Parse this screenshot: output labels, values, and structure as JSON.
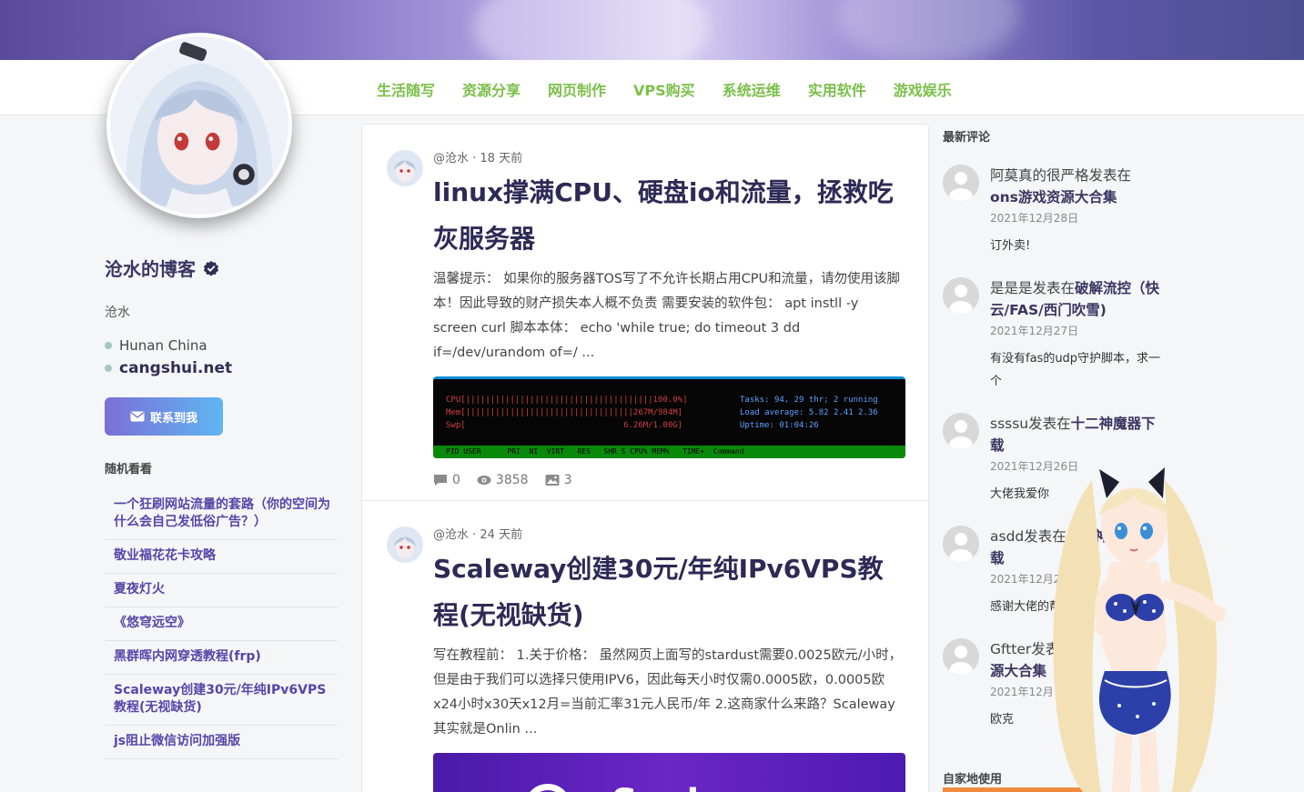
{
  "nav": {
    "items": [
      "生活随写",
      "资源分享",
      "网页制作",
      "VPS购买",
      "系统运维",
      "实用软件",
      "游戏娱乐"
    ]
  },
  "profile": {
    "title": "沧水的博客",
    "subtitle": "沧水",
    "location": "Hunan China",
    "site": "cangshui.net",
    "contact_label": "联系到我"
  },
  "random": {
    "heading": "随机看看",
    "items": [
      "一个狂刷网站流量的套路（你的空间为什么会自己发低俗广告？）",
      "敬业福花花卡攻略",
      "夏夜灯火",
      "《悠穹远空》",
      "黑群晖内网穿透教程(frp)",
      "Scaleway创建30元/年纯IPv6VPS教程(无视缺货)",
      "js阻止微信访问加强版"
    ]
  },
  "posts": [
    {
      "meta": "@沧水 · 18 天前",
      "title": "linux撑满CPU、硬盘io和流量，拯救吃灰服务器",
      "excerpt": "温馨提示： 如果你的服务器TOS写了不允许长期占用CPU和流量，请勿使用该脚本！因此导致的财产损失本人概不负责 需要安装的软件包： apt instll -y screen curl 脚本本体： echo 'while true; do timeout 3 dd if=/dev/urandom of=/ ...",
      "comments": "0",
      "views": "3858",
      "images": "3",
      "term": {
        "left": "CPU[||||||||||||||||||||||||||||||||||||||100.0%]\nMem[||||||||||||||||||||||||||||||||||267M/984M]\nSwp[                                6.26M/1.00G]",
        "right": "Tasks: 94, 29 thr; 2 running\nLoad average: 5.82 2.41 2.36\nUptime: 01:04:26",
        "bar": "PID USER      PRI  NI  VIRT   RES   SHR S CPU% MEM%   TIME+  Command"
      }
    },
    {
      "meta": "@沧水 · 24 天前",
      "title": "Scaleway创建30元/年纯IPv6VPS教程(无视缺货)",
      "excerpt": "写在教程前： 1.关于价格： 虽然网页上面写的stardust需要0.0025欧元/小时，但是由于我们可以选择只使用IPV6，因此每天小时仅需0.0005欧，0.0005欧x24小时x30天x12月=当前汇率31元人民币/年 2.这商家什么来路？Scaleway其实就是Onlin ...",
      "image_text": "Scaleway"
    }
  ],
  "comments": {
    "heading": "最新评论",
    "items": [
      {
        "author": "阿莫真的很严格",
        "verb": "发表在",
        "post": "ons游戏资源大合集",
        "date": "2021年12月28日",
        "text": "订外卖!"
      },
      {
        "author": "是是是",
        "verb": "发表在",
        "post": "破解流控（快云/FAS/西门吹雪)",
        "date": "2021年12月27日",
        "text": "有没有fas的udp守护脚本，求一个"
      },
      {
        "author": "ssssu",
        "verb": "发表在",
        "post": "十二神魔器下载",
        "date": "2021年12月26日",
        "text": "大佬我爱你"
      },
      {
        "author": "asdd",
        "verb": "发表在",
        "post": "十二神魔器下载",
        "date": "2021年12月2",
        "text": "感谢大佬的帮助"
      },
      {
        "author": "Gftter",
        "verb": "发表",
        "post": "源大合集",
        "date": "2021年12月",
        "text": "欧克"
      }
    ]
  },
  "bottom_heading": "自家地使用",
  "colors": {
    "nav": "#7bbf4a",
    "link": "#5546a8",
    "title": "#2d2a55",
    "accent_orange": "#f08a3c"
  }
}
